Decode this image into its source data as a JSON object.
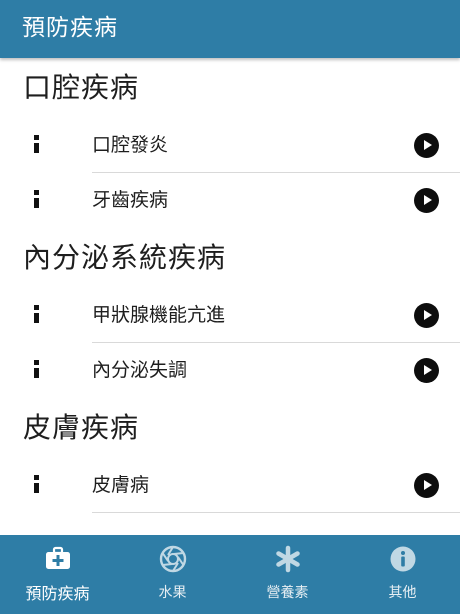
{
  "appbar": {
    "title": "預防疾病"
  },
  "sections": [
    {
      "title": "口腔疾病",
      "items": [
        {
          "label": "口腔發炎"
        },
        {
          "label": "牙齒疾病"
        }
      ]
    },
    {
      "title": "內分泌系統疾病",
      "items": [
        {
          "label": "甲狀腺機能亢進"
        },
        {
          "label": "內分泌失調"
        }
      ]
    },
    {
      "title": "皮膚疾病",
      "items": [
        {
          "label": "皮膚病"
        }
      ]
    }
  ],
  "tabs": [
    {
      "label": "預防疾病",
      "icon": "medical-kit-icon",
      "active": true
    },
    {
      "label": "水果",
      "icon": "aperture-icon",
      "active": false
    },
    {
      "label": "營養素",
      "icon": "asterisk-icon",
      "active": false
    },
    {
      "label": "其他",
      "icon": "info-icon",
      "active": false
    }
  ],
  "colors": {
    "primary": "#2e7da6",
    "text": "#1e1e1e"
  }
}
